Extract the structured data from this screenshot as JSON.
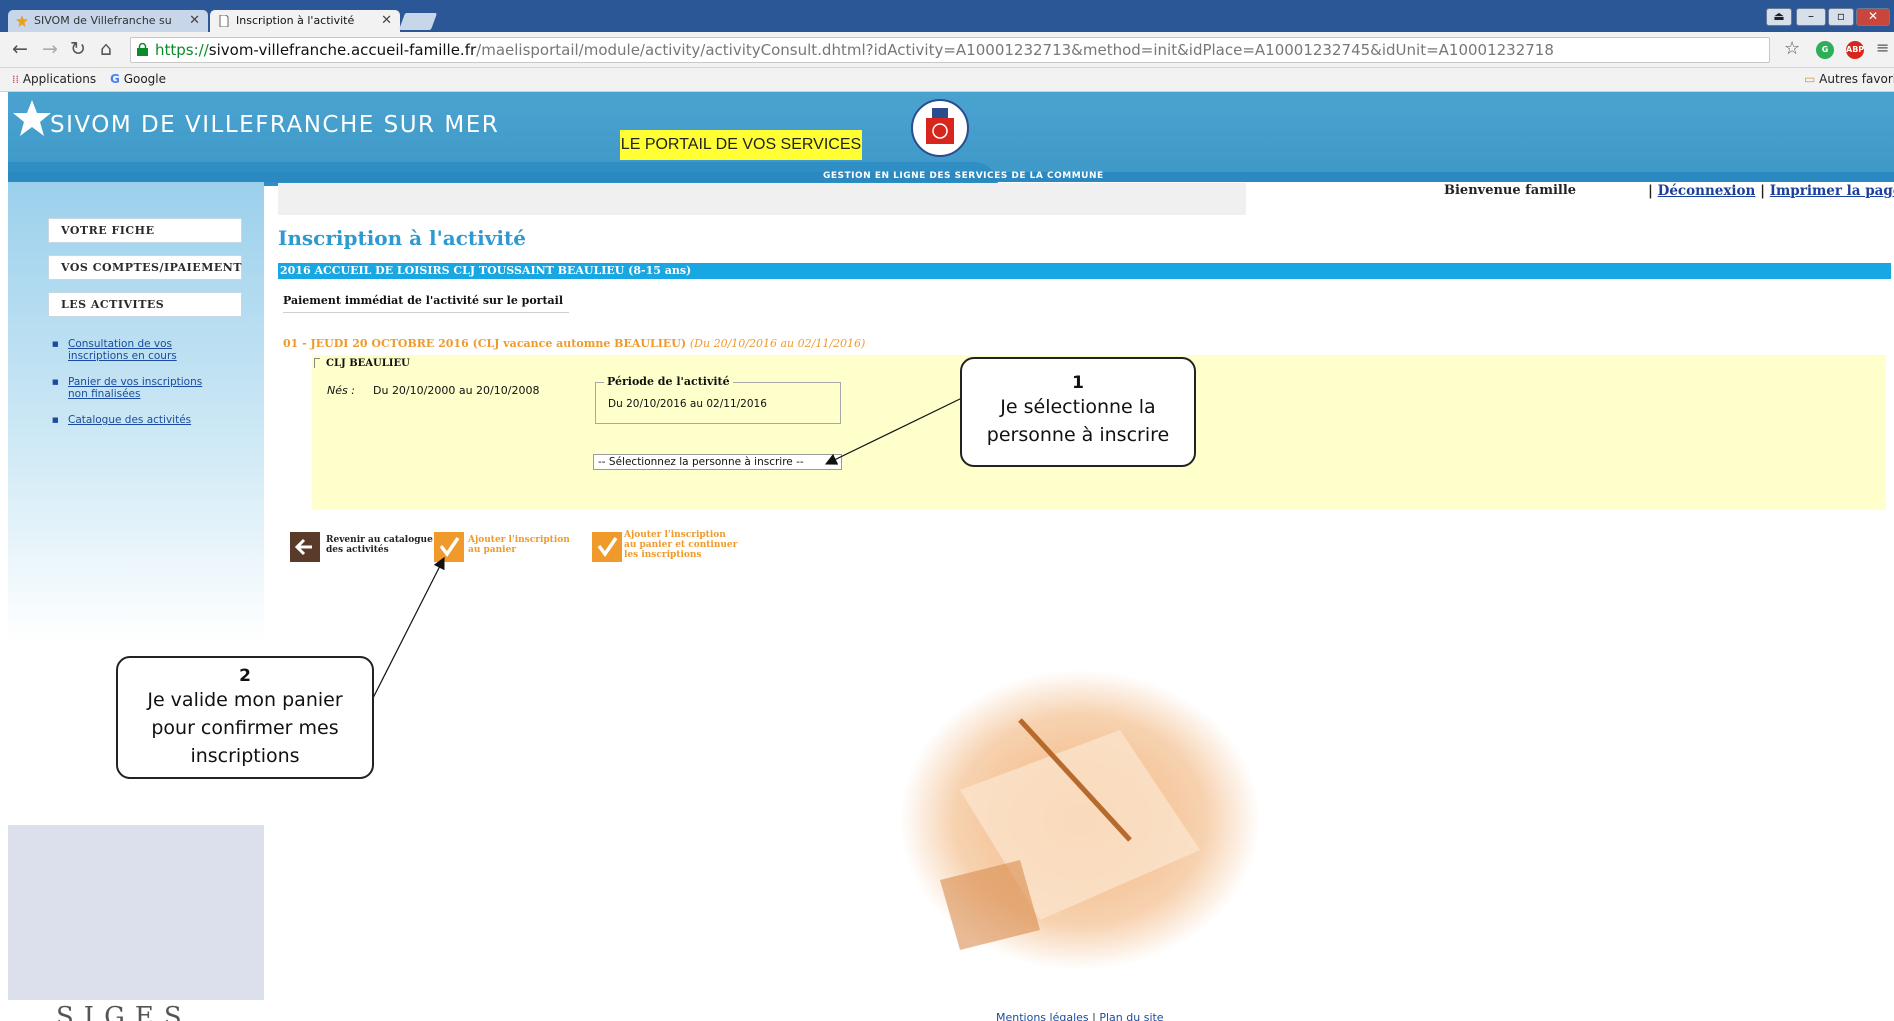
{
  "browser": {
    "tabs": [
      {
        "label": "SIVOM de Villefranche su"
      },
      {
        "label": "Inscription à l'activité"
      }
    ],
    "url": {
      "protocol": "https://",
      "host": "sivom-villefranche.accueil-famille.fr",
      "path": "/maelisportail/module/activity/activityConsult.dhtml?idActivity=A10001232713&method=init&idPlace=A10001232745&idUnit=A10001232718"
    },
    "bookmarks": {
      "apps": "Applications",
      "google": "Google",
      "other": "Autres favoris"
    },
    "extensions": {
      "abp": "ABP"
    }
  },
  "header": {
    "site_title": "SIVOM DE VILLEFRANCHE SUR MER",
    "portal_badge": "LE PORTAIL DE VOS SERVICES",
    "tagline": "GESTION EN LIGNE DES SERVICES DE LA COMMUNE",
    "colors": {
      "header": "#4aa3cf",
      "badge": "#ffff33",
      "accent": "#19a7e3",
      "orange": "#ef9a2b"
    }
  },
  "sidebar": {
    "buttons": [
      "VOTRE FICHE",
      "VOS COMPTES/IPAIEMENT",
      "LES ACTIVITES"
    ],
    "links": [
      [
        "Consultation de vos",
        "inscriptions en cours"
      ],
      [
        "Panier de vos inscriptions",
        "non finalisées"
      ],
      [
        "Catalogue des activités"
      ]
    ],
    "footer_logo": "SIGES"
  },
  "topbar": {
    "welcome": "Bienvenue famille",
    "separator": "|",
    "logout": "Déconnexion",
    "print": "Imprimer la page"
  },
  "main": {
    "title": "Inscription à l'activité",
    "activity_name": "2016 ACCUEIL DE LOISIRS CLJ TOUSSAINT BEAULIEU (8-15 ans)",
    "payment_note": "Paiement immédiat de l'activité sur le portail",
    "session": {
      "label": "01 - JEUDI 20 OCTOBRE 2016 (CLJ vacance automne BEAULIEU)",
      "dates": "(Du 20/10/2016 au 02/11/2016)"
    },
    "site_name": "CLJ BEAULIEU",
    "born_label": "Nés :",
    "born_value": "Du 20/10/2000 au 20/10/2008",
    "period_legend": "Période de l'activité",
    "period_value": "Du 20/10/2016 au 02/11/2016",
    "person_select": "-- Sélectionnez la personne à inscrire --",
    "actions": {
      "back": [
        "Revenir au catalogue",
        "des activités"
      ],
      "add_cart": [
        "Ajouter l'inscription",
        "au panier"
      ],
      "add_continue": [
        "Ajouter l'inscription",
        "au panier et continuer",
        "les inscriptions"
      ]
    }
  },
  "callouts": [
    {
      "number": "1",
      "lines": [
        "Je sélectionne la",
        "personne à inscrire"
      ]
    },
    {
      "number": "2",
      "lines": [
        "Je valide mon panier",
        "pour confirmer mes",
        "inscriptions"
      ]
    }
  ],
  "footer": {
    "legal": "Mentions légales",
    "separator": "|",
    "sitemap": "Plan du site"
  }
}
